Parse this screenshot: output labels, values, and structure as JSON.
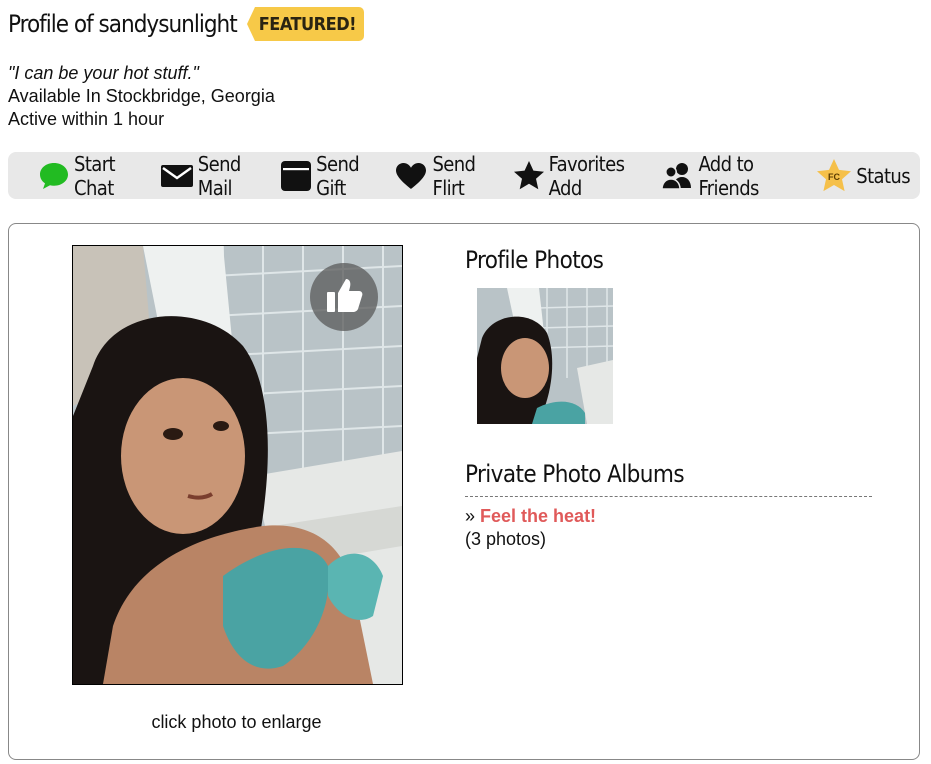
{
  "header": {
    "title": "Profile of sandysunlight",
    "featured_label": "FEATURED!"
  },
  "profile": {
    "tagline": "\"I can be your hot stuff.\"",
    "location": "Available In Stockbridge, Georgia",
    "activity": "Active within 1 hour"
  },
  "actions": [
    {
      "label": "Start Chat",
      "icon": "chat-bubble-icon",
      "color": "#22bb22"
    },
    {
      "label": "Send Mail",
      "icon": "envelope-icon"
    },
    {
      "label": "Send Gift",
      "icon": "gift-box-icon"
    },
    {
      "label": "Send Flirt",
      "icon": "heart-icon"
    },
    {
      "label": "Favorites Add",
      "icon": "star-icon"
    },
    {
      "label": "Add to Friends",
      "icon": "friends-icon"
    },
    {
      "label": "Status",
      "icon": "fc-star-badge-icon",
      "badge": "FC",
      "color": "#f5c04a"
    }
  ],
  "photo": {
    "caption": "click photo to enlarge",
    "like_icon": "thumbs-up-icon"
  },
  "profile_photos": {
    "heading": "Profile Photos"
  },
  "private_albums": {
    "heading": "Private Photo Albums",
    "bullet": "»",
    "album_name": "Feel the heat!",
    "album_count": "(3 photos)",
    "link_color": "#e05a5a"
  },
  "colors": {
    "featured": "#f7c948",
    "action_bar": "#e8e8e8"
  }
}
